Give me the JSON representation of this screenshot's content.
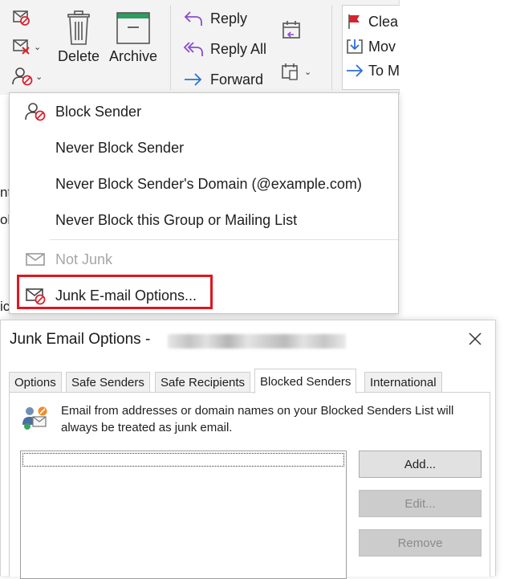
{
  "ribbon": {
    "delete_label": "Delete",
    "archive_label": "Archive",
    "reply_label": "Reply",
    "reply_all_label": "Reply All",
    "forward_label": "Forward",
    "clear_label": "Clea",
    "move_label": "Mov",
    "to_manager_label": "To M"
  },
  "left_fragments": [
    "nt",
    "ol",
    "ic"
  ],
  "junk_menu": {
    "items": [
      {
        "label": "Block Sender",
        "icon": "block-sender-icon",
        "enabled": true
      },
      {
        "label": "Never Block Sender",
        "enabled": true
      },
      {
        "label": "Never Block Sender's Domain (@example.com)",
        "enabled": true
      },
      {
        "label": "Never Block this Group or Mailing List",
        "enabled": true
      },
      {
        "label": "Not Junk",
        "icon": "envelope-icon",
        "enabled": false
      },
      {
        "label": "Junk E-mail Options...",
        "icon": "junk-options-icon",
        "enabled": true,
        "highlighted": true
      }
    ]
  },
  "dialog": {
    "title": "Junk Email Options -",
    "tabs": [
      {
        "label": "Options",
        "active": false
      },
      {
        "label": "Safe Senders",
        "active": false
      },
      {
        "label": "Safe Recipients",
        "active": false
      },
      {
        "label": "Blocked Senders",
        "active": true
      },
      {
        "label": "International",
        "active": false
      }
    ],
    "info_text": "Email from addresses or domain names on your Blocked Senders List will always be treated as junk email.",
    "buttons": {
      "add": "Add...",
      "edit": "Edit...",
      "remove": "Remove"
    }
  },
  "colors": {
    "highlight_border": "#e0161f",
    "accent_blue": "#2b6fd6",
    "block_red": "#d4242f"
  }
}
